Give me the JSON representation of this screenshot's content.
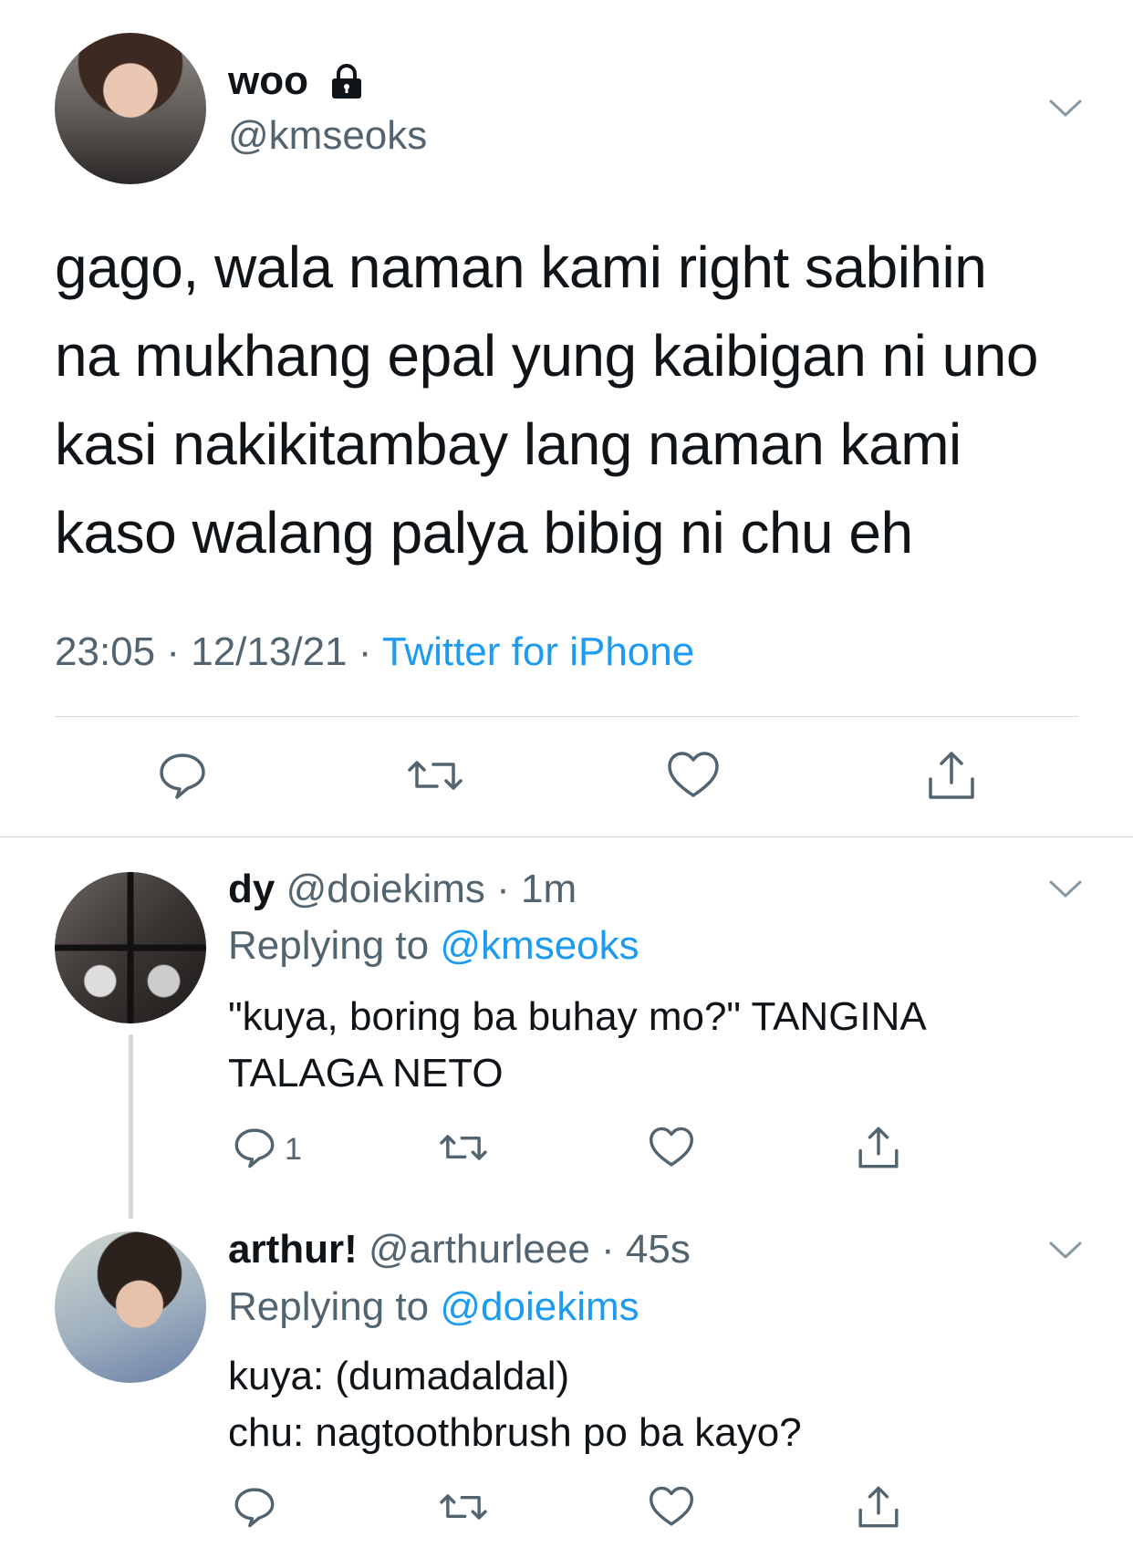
{
  "main_tweet": {
    "display_name": "woo",
    "handle": "@kmseoks",
    "text": "gago, wala naman kami right sabihin\nna mukhang epal yung kaibigan ni uno\nkasi nakikitambay lang naman kami\nkaso walang palya bibig ni chu eh",
    "time": "23:05",
    "date": "12/13/21",
    "source": "Twitter for iPhone",
    "icons": {
      "lock": "lock-icon",
      "reply": "reply-icon",
      "retweet": "retweet-icon",
      "like": "like-icon",
      "share": "share-icon",
      "more": "chevron-down-icon"
    }
  },
  "replies": [
    {
      "display_name": "dy",
      "handle": "@doiekims",
      "age": "1m",
      "replying_prefix": "Replying to",
      "replying_to": "@kmseoks",
      "text": "\"kuya, boring ba buhay mo?\" TANGINA\nTALAGA NETO",
      "reply_count": "1"
    },
    {
      "display_name": "arthur!",
      "handle": "@arthurleee",
      "age": "45s",
      "replying_prefix": "Replying to",
      "replying_to": "@doiekims",
      "text": "kuya: (dumadaldal)\nchu: nagtoothbrush po ba kayo?",
      "reply_count": ""
    }
  ],
  "colors": {
    "text": "#0f1419",
    "secondary": "#536471",
    "link": "#1d9bf0",
    "divider": "#cfd9de"
  }
}
